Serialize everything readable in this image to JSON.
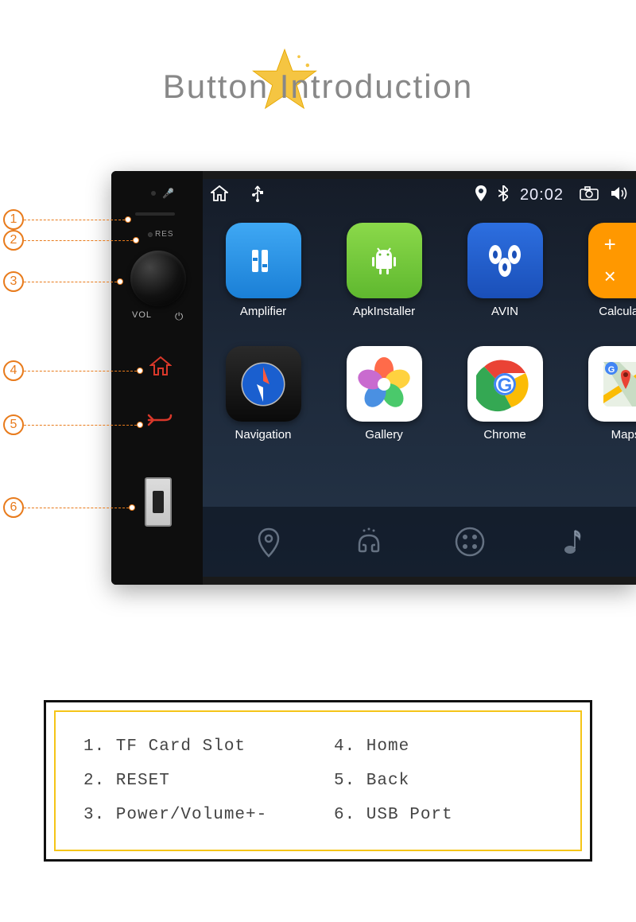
{
  "title": "Button Introduction",
  "status_bar": {
    "time": "20:02"
  },
  "side": {
    "res": "RES",
    "vol": "VOL"
  },
  "apps": [
    {
      "label": "Amplifier"
    },
    {
      "label": "ApkInstaller"
    },
    {
      "label": "AVIN"
    },
    {
      "label": "Calculator"
    },
    {
      "label": "Navigation"
    },
    {
      "label": "Gallery"
    },
    {
      "label": "Chrome"
    },
    {
      "label": "Maps"
    }
  ],
  "callouts": [
    "1",
    "2",
    "3",
    "4",
    "5",
    "6"
  ],
  "legend": [
    "1. TF Card Slot",
    "4. Home",
    "2. RESET",
    "5. Back",
    "3. Power/Volume+-",
    "6. USB Port"
  ]
}
